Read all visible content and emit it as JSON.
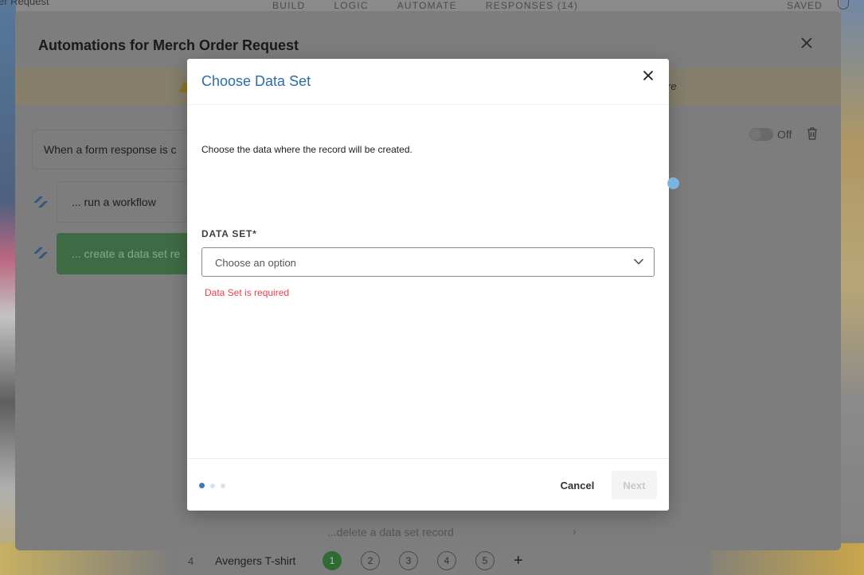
{
  "background": {
    "title_fragment": "er Request",
    "tabs": [
      "BUILD",
      "LOGIC",
      "AUTOMATE",
      "RESPONSES (14)"
    ],
    "saved_label": "SAVED",
    "table_row": {
      "number": "4",
      "name": "Avengers T-shirt",
      "steps": [
        "1",
        "2",
        "3",
        "4",
        "5"
      ],
      "add_label": "+"
    }
  },
  "automations": {
    "title": "Automations for Merch Order Request",
    "banner_tail": "re",
    "trigger_text": "When a form response is c",
    "steps": [
      {
        "label": "... run a workflow"
      },
      {
        "label": "... create a data set re"
      }
    ],
    "toggle_label": "Off",
    "delete_record_label": "...delete a data set record",
    "delete_record_chevron": "›"
  },
  "modal": {
    "title": "Choose Data Set",
    "description": "Choose the data where the record will be created.",
    "field_label": "DATA SET*",
    "select_placeholder": "Choose an option",
    "error": "Data Set is required",
    "cancel_label": "Cancel",
    "next_label": "Next",
    "step_count": 3,
    "current_step": 1
  },
  "colors": {
    "title_blue": "#2e6ca5",
    "error_red": "#e0424f",
    "dot_active": "#3d78c4"
  }
}
